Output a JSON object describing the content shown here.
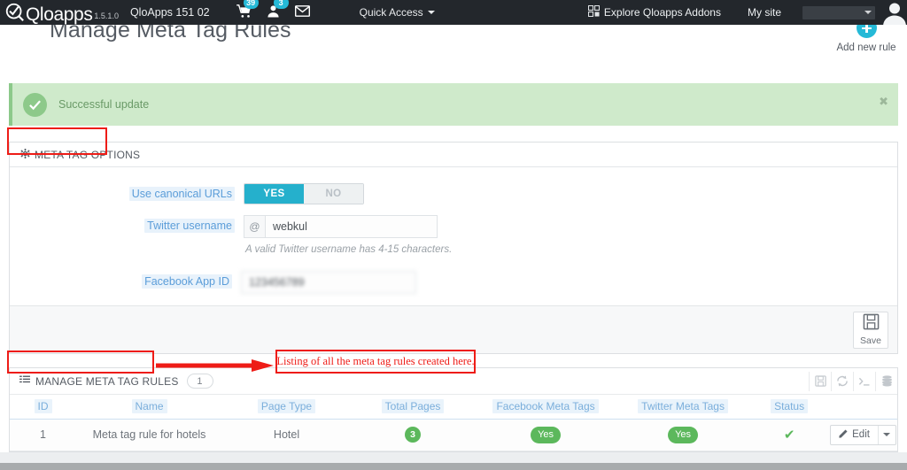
{
  "header": {
    "logo_text": "Qloapps",
    "logo_version": "1.5.1.0",
    "shop_name": "QloApps 151 02",
    "cart_badge": "39",
    "customer_badge": "3",
    "quick_access_label": "Quick Access",
    "addons_label": "Explore Qloapps Addons",
    "my_site_label": "My site",
    "shop_select_value": "",
    "icons": {
      "cart": "cart-icon",
      "customers": "customer-icon",
      "messages": "envelope-icon",
      "addons": "addons-icon",
      "avatar": "avatar-icon"
    }
  },
  "page": {
    "title": "Manage Meta Tag Rules",
    "add_new_label": "Add new rule"
  },
  "alert": {
    "message": "Successful update",
    "close_label": "✖",
    "bg_color": "#cfeacb",
    "text_color": "#6a9a67"
  },
  "options_panel": {
    "title": "META TAG OPTIONS",
    "fields": {
      "canonical": {
        "label": "Use canonical URLs",
        "yes_label": "YES",
        "no_label": "NO",
        "selected": "YES"
      },
      "twitter": {
        "label": "Twitter username",
        "prefix": "@",
        "value": "webkul",
        "placeholder": "",
        "hint": "A valid Twitter username has 4-15 characters."
      },
      "facebook": {
        "label": "Facebook App ID",
        "value": "123456789",
        "placeholder": ""
      }
    },
    "save_label": "Save"
  },
  "rules_panel": {
    "title": "MANAGE META TAG RULES",
    "count": "1",
    "toolbar": [
      "export-icon",
      "refresh-icon",
      "sql-query-icon",
      "database-icon"
    ],
    "columns": [
      "ID",
      "Name",
      "Page Type",
      "Total Pages",
      "Facebook Meta Tags",
      "Twitter Meta Tags",
      "Status"
    ],
    "rows": [
      {
        "id": "1",
        "name": "Meta tag rule for hotels",
        "page_type": "Hotel",
        "total_pages": "3",
        "facebook_meta_tags": "Yes",
        "twitter_meta_tags": "Yes",
        "status": "✔",
        "action_label": "Edit"
      }
    ]
  },
  "annotations": {
    "note_text": "Listing of all the meta tag rules created here.",
    "color": "#ee1c17"
  },
  "theme": {
    "accent": "#25b9d7",
    "toggle_on": "#25b0cc",
    "success": "#5cb85c",
    "header_bg": "#23272c",
    "label_blue": "#5b9dd9"
  }
}
